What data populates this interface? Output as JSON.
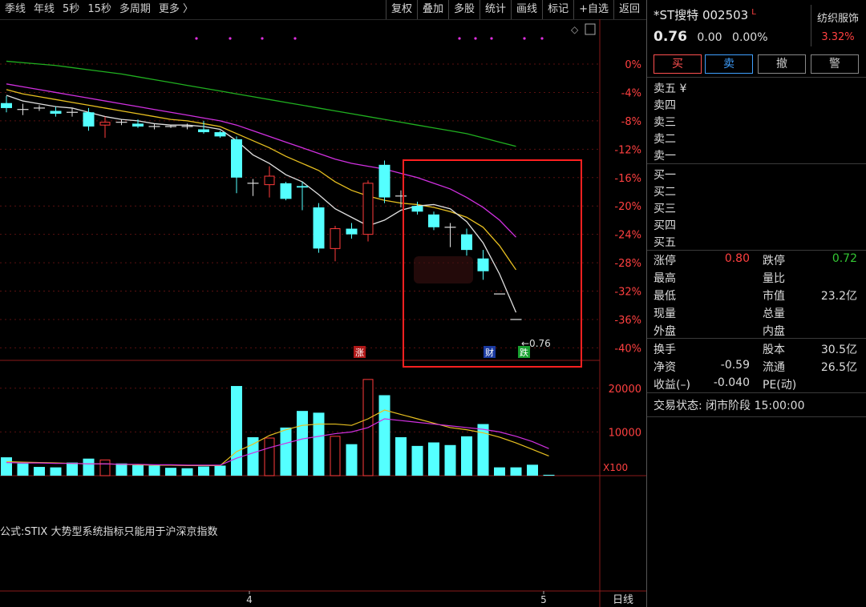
{
  "toolbar": {
    "periods": [
      "季线",
      "年线",
      "5秒",
      "15秒",
      "多周期",
      "更多 〉"
    ],
    "actions": [
      "复权",
      "叠加",
      "多股",
      "统计",
      "画线",
      "标记",
      "+自选",
      "返回"
    ]
  },
  "stock": {
    "name": "*ST搜特 002503",
    "flag": "L",
    "price": "0.76",
    "change": "0.00",
    "change_pct": "0.00%",
    "sector": "纺织服饰",
    "sector_pct": "3.32%"
  },
  "trade_buttons": [
    "买",
    "卖",
    "撤",
    "警"
  ],
  "order_book": {
    "sell": [
      "卖五 ¥",
      "卖四",
      "卖三",
      "卖二",
      "卖一"
    ],
    "buy": [
      "买一",
      "买二",
      "买三",
      "买四",
      "买五"
    ]
  },
  "quote": [
    {
      "l1": "涨停",
      "v1": "0.80",
      "c1": "#ff4040",
      "l2": "跌停",
      "v2": "0.72",
      "c2": "#34c734"
    },
    {
      "l1": "最高",
      "v1": "",
      "c1": "#dcdcdc",
      "l2": "量比",
      "v2": "",
      "c2": "#dcdcdc"
    },
    {
      "l1": "最低",
      "v1": "",
      "c1": "#dcdcdc",
      "l2": "市值",
      "v2": "23.2亿",
      "c2": "#dcdcdc"
    },
    {
      "l1": "现量",
      "v1": "",
      "c1": "#dcdcdc",
      "l2": "总量",
      "v2": "",
      "c2": "#dcdcdc"
    },
    {
      "l1": "外盘",
      "v1": "",
      "c1": "#dcdcdc",
      "l2": "内盘",
      "v2": "",
      "c2": "#dcdcdc"
    }
  ],
  "finance": [
    {
      "l1": "换手",
      "v1": "",
      "l2": "股本",
      "v2": "30.5亿"
    },
    {
      "l1": "净资",
      "v1": "-0.59",
      "l2": "流通",
      "v2": "26.5亿"
    },
    {
      "l1": "收益(–)",
      "v1": "-0.040",
      "l2": "PE(动)",
      "v2": ""
    }
  ],
  "trade_status": "交易状态: 闭市阶段 15:00:00",
  "formula_note": "公式:STIX 大势型系统指标只能用于沪深京指数",
  "volume_unit": "X100",
  "period_label": "日线",
  "markers": {
    "zhang": "涨",
    "cai": "财",
    "die": "跌",
    "last": "0.76"
  },
  "colors": {
    "up": "#ff3b3b",
    "down": "#54ffff",
    "ma5": "#e0e0e0",
    "ma10": "#e8c020",
    "ma20": "#d030e0",
    "ma60": "#20b020",
    "highlight": "#ff2020"
  },
  "chart_data": {
    "type": "candlestick",
    "y_axis_pct_ticks": [
      "0%",
      "-4%",
      "-8%",
      "-12%",
      "-16%",
      "-20%",
      "-24%",
      "-28%",
      "-32%",
      "-36%",
      "-40%"
    ],
    "x_ticks": [
      "4",
      "5"
    ],
    "volume_ticks": [
      "20000",
      "10000"
    ],
    "candles_pct": [
      [
        -5.5,
        -4.5,
        -6.8,
        -6.2
      ],
      [
        -6.4,
        -5.6,
        -7.2,
        -6.4
      ],
      [
        -6.2,
        -5.8,
        -6.6,
        -6.2
      ],
      [
        -6.6,
        -6.0,
        -7.4,
        -7.0
      ],
      [
        -6.8,
        -6.2,
        -7.4,
        -6.8
      ],
      [
        -6.8,
        -6.2,
        -9.4,
        -8.8
      ],
      [
        -8.6,
        -7.4,
        -10.4,
        -8.2
      ],
      [
        -8.2,
        -7.8,
        -8.6,
        -8.2
      ],
      [
        -8.4,
        -7.8,
        -9.0,
        -8.8
      ],
      [
        -8.8,
        -8.4,
        -9.2,
        -8.8
      ],
      [
        -8.8,
        -8.6,
        -9.0,
        -8.8
      ],
      [
        -8.8,
        -8.4,
        -9.2,
        -8.8
      ],
      [
        -9.2,
        -8.0,
        -9.8,
        -9.6
      ],
      [
        -9.6,
        -9.4,
        -10.4,
        -10.2
      ],
      [
        -10.6,
        -10.2,
        -18.2,
        -16.0
      ],
      [
        -16.8,
        -16.2,
        -18.6,
        -16.8
      ],
      [
        -17.0,
        -14.4,
        -18.8,
        -15.8
      ],
      [
        -16.8,
        -16.6,
        -19.2,
        -19.0
      ],
      [
        -17.2,
        -16.6,
        -20.6,
        -17.4
      ],
      [
        -20.2,
        -19.6,
        -26.6,
        -26.0
      ],
      [
        -26.0,
        -22.8,
        -27.8,
        -23.2
      ],
      [
        -23.2,
        -22.4,
        -24.6,
        -24.0
      ],
      [
        -24.0,
        -16.4,
        -25.0,
        -16.8
      ],
      [
        -14.2,
        -13.6,
        -19.6,
        -18.8
      ],
      [
        -18.6,
        -17.8,
        -20.2,
        -18.6
      ],
      [
        -20.0,
        -19.4,
        -21.2,
        -20.8
      ],
      [
        -21.2,
        -20.8,
        -23.4,
        -23.0
      ],
      [
        -23.0,
        -22.4,
        -25.8,
        -23.0
      ],
      [
        -24.0,
        -23.2,
        -27.0,
        -26.2
      ],
      [
        -27.4,
        -26.2,
        -30.4,
        -29.2
      ],
      [
        -32.4,
        -32.4,
        -32.4,
        -32.4
      ],
      [
        -36.0,
        -36.0,
        -36.0,
        -36.0
      ]
    ],
    "ma5_pct": [
      -4.4,
      -5.2,
      -5.6,
      -6.0,
      -6.2,
      -6.8,
      -7.4,
      -7.8,
      -8.0,
      -8.4,
      -8.6,
      -8.6,
      -8.8,
      -9.2,
      -10.8,
      -12.8,
      -14.0,
      -15.6,
      -16.6,
      -18.4,
      -20.4,
      -21.6,
      -22.8,
      -22.0,
      -20.6,
      -20.0,
      -19.8,
      -20.4,
      -22.2,
      -25.2,
      -29.6,
      -35.0
    ],
    "ma10_pct": [
      -3.6,
      -4.2,
      -4.6,
      -5.0,
      -5.4,
      -5.8,
      -6.2,
      -6.6,
      -7.0,
      -7.4,
      -7.8,
      -8.0,
      -8.4,
      -8.8,
      -9.8,
      -10.8,
      -11.8,
      -13.0,
      -14.0,
      -15.0,
      -16.6,
      -17.8,
      -18.6,
      -19.2,
      -19.6,
      -19.8,
      -20.2,
      -20.8,
      -21.6,
      -23.0,
      -25.6,
      -29.0
    ],
    "ma20_pct": [
      -2.8,
      -3.2,
      -3.6,
      -4.0,
      -4.4,
      -4.8,
      -5.2,
      -5.6,
      -6.0,
      -6.4,
      -6.8,
      -7.2,
      -7.6,
      -8.0,
      -8.6,
      -9.4,
      -10.2,
      -11.0,
      -11.8,
      -12.6,
      -13.4,
      -14.0,
      -14.4,
      -14.8,
      -15.4,
      -16.0,
      -16.8,
      -17.6,
      -18.8,
      -20.2,
      -22.0,
      -24.4
    ],
    "ma60_pct": [
      0.4,
      0.2,
      0.0,
      -0.2,
      -0.5,
      -0.8,
      -1.1,
      -1.4,
      -1.8,
      -2.2,
      -2.6,
      -3.0,
      -3.4,
      -3.8,
      -4.2,
      -4.6,
      -5.0,
      -5.4,
      -5.8,
      -6.2,
      -6.6,
      -7.0,
      -7.4,
      -7.8,
      -8.2,
      -8.6,
      -9.0,
      -9.4,
      -9.8,
      -10.4,
      -11.0,
      -11.6
    ],
    "volume": [
      4200,
      2800,
      2000,
      1900,
      3000,
      3900,
      3600,
      2800,
      2400,
      2300,
      1800,
      1700,
      2100,
      2300,
      20500,
      8800,
      8600,
      11000,
      14800,
      14400,
      9000,
      7200,
      22000,
      18400,
      8800,
      6800,
      7600,
      7000,
      9000,
      11800,
      1900,
      1900,
      2500,
      200
    ],
    "vol_ma_a": [
      3200,
      3100,
      3000,
      2900,
      2800,
      2700,
      2700,
      2600,
      2500,
      2400,
      2400,
      2300,
      2300,
      2300,
      5500,
      7200,
      9200,
      10500,
      11500,
      11800,
      11800,
      11500,
      13000,
      15000,
      14000,
      13000,
      12000,
      11000,
      10500,
      9800,
      8800,
      7500,
      6000,
      4500
    ],
    "vol_ma_b": [
      3000,
      2900,
      2900,
      2800,
      2800,
      2700,
      2700,
      2600,
      2600,
      2500,
      2500,
      2400,
      2400,
      2400,
      4000,
      5200,
      6400,
      7400,
      8400,
      9000,
      9600,
      10000,
      11000,
      13000,
      12600,
      12200,
      11800,
      11400,
      11000,
      10600,
      10000,
      9000,
      7800,
      6200
    ]
  }
}
